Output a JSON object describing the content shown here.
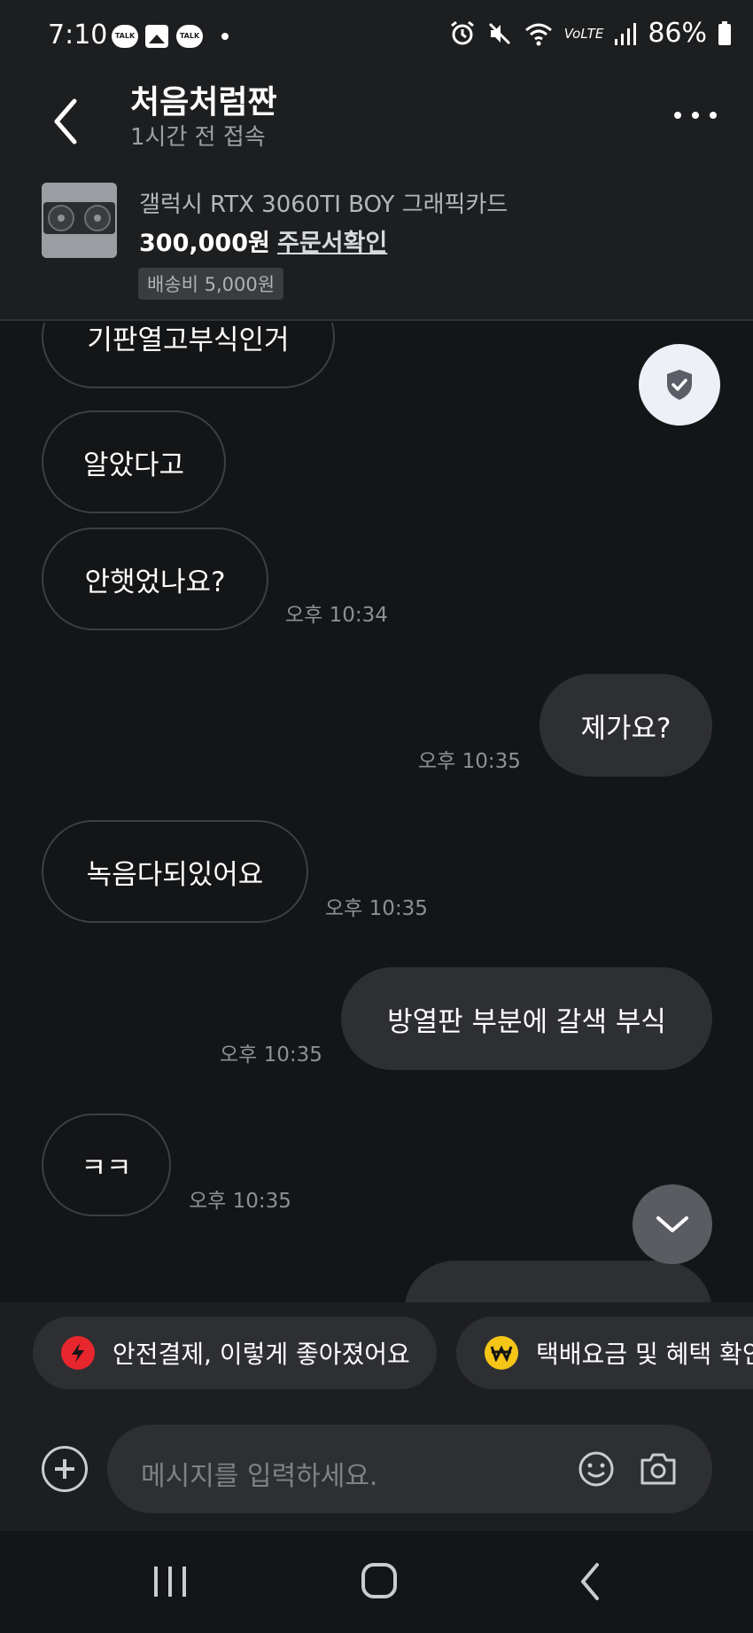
{
  "status_bar": {
    "time": "7:10",
    "talk_label": "TALK",
    "network": "VoLTE",
    "battery": "86%"
  },
  "header": {
    "title": "처음처럼짠",
    "subtitle": "1시간 전 접속"
  },
  "product": {
    "name": "갤럭시 RTX 3060TI BOY 그래픽카드",
    "price": "300,000원",
    "order_link": "주문서확인",
    "shipping": "배송비 5,000원"
  },
  "messages": [
    {
      "side": "in",
      "text": "기판열고부식인거",
      "time": ""
    },
    {
      "side": "in",
      "text": "알았다고",
      "time": ""
    },
    {
      "side": "in",
      "text": "안햇었나요?",
      "time": "오후 10:34"
    },
    {
      "side": "out",
      "text": "제가요?",
      "time": "오후 10:35"
    },
    {
      "side": "in",
      "text": "녹음다되있어요",
      "time": "오후 10:35"
    },
    {
      "side": "out",
      "text": "방열판 부분에 갈색 부식",
      "time": "오후 10:35"
    },
    {
      "side": "in",
      "text": "ㅋㅋ",
      "time": "오후 10:35"
    }
  ],
  "suggestions": [
    {
      "label": "안전결제, 이렇게 좋아졌어요",
      "icon": "lightning-icon",
      "color": "#e8262d"
    },
    {
      "label": "택배요금 및 혜택 확인",
      "icon": "won-icon",
      "color": "#f5c518"
    }
  ],
  "composer": {
    "placeholder": "메시지를 입력하세요."
  },
  "colors": {
    "background": "#141517",
    "panel": "#1d1e20",
    "bubble_out": "#2e2f33",
    "bubble_in_border": "#3d3f44",
    "timestamp": "#8d9095"
  }
}
